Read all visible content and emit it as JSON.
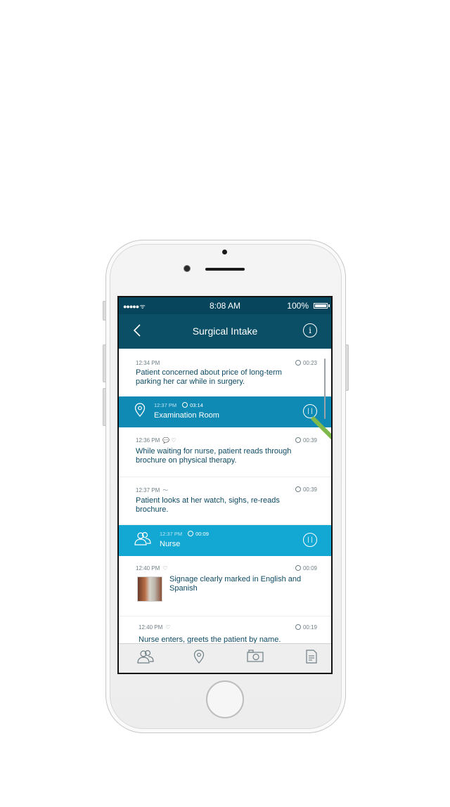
{
  "status_bar": {
    "signal": "●●●●● ᯤ",
    "time": "8:08 AM",
    "battery": "100%"
  },
  "nav": {
    "title": "Surgical Intake",
    "back_icon": "chevron-left-icon",
    "info_icon": "info-icon"
  },
  "feed": {
    "notes": [
      {
        "time": "12:34 PM",
        "duration": "00:23",
        "text_line1": "Patient concerned about price of long-term",
        "text_line2": "parking her car while in surgery."
      },
      {
        "time": "12:36 PM",
        "duration": "00:39",
        "icons": "💬 ♡",
        "text_line1": "While waiting for nurse, patient reads through",
        "text_line2": "brochure on physical therapy."
      },
      {
        "time": "12:37 PM",
        "duration": "00:39",
        "icons": "〜",
        "text_line1": "Patient looks at her watch, sighs, re-reads",
        "text_line2": "brochure."
      },
      {
        "time": "12:40 PM",
        "duration": "00:09",
        "icons": "♡",
        "text_line1": "Signage clearly marked in English and",
        "text_line2": "Spanish"
      },
      {
        "time": "12:40 PM",
        "duration": "00:19",
        "icons": "♡",
        "text_line1": "Nurse enters, greets the patient by name."
      }
    ],
    "bands": [
      {
        "time": "12:37 PM",
        "duration": "03:14",
        "label": "Examination Room",
        "icon": "location-pin-icon",
        "color": "#0f8ab4"
      },
      {
        "time": "12:37 PM",
        "duration": "00:09",
        "label": "Nurse",
        "icon": "people-icon",
        "color": "#13a7d3"
      }
    ]
  },
  "tabbar": [
    "people-icon",
    "location-pin-icon",
    "camera-icon",
    "document-icon"
  ]
}
